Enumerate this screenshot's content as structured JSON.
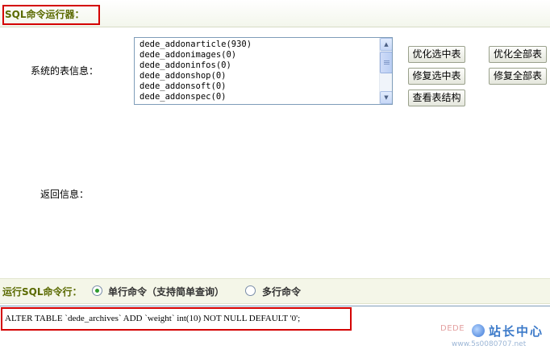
{
  "header": {
    "title": "SQL命令运行器："
  },
  "tables": {
    "label": "系统的表信息：",
    "items": [
      "dede_addonarticle(930)",
      "dede_addonimages(0)",
      "dede_addoninfos(0)",
      "dede_addonshop(0)",
      "dede_addonsoft(0)",
      "dede_addonspec(0)"
    ]
  },
  "buttons": {
    "optimize_selected": "优化选中表",
    "optimize_all": "优化全部表",
    "repair_selected": "修复选中表",
    "repair_all": "修复全部表",
    "view_structure": "查看表结构"
  },
  "result": {
    "label": "返回信息："
  },
  "command": {
    "label": "运行SQL命令行：",
    "single_label": "单行命令（支持简单查询）",
    "multi_label": "多行命令",
    "selected": "single",
    "sql": "ALTER TABLE `dede_archives`  ADD `weight` int(10) NOT NULL DEFAULT '0';"
  },
  "watermark": {
    "logo_text": "DEDE",
    "brand": "站长中心",
    "url": "www.5s0080707.net"
  },
  "icons": {
    "scroll_up": "chevron-up-icon",
    "scroll_down": "chevron-down-icon"
  }
}
